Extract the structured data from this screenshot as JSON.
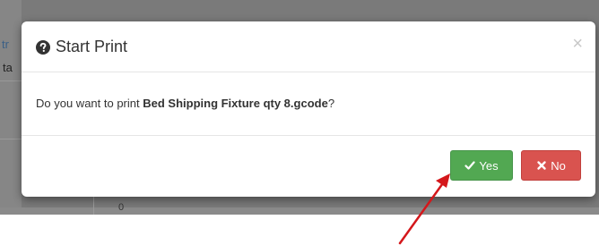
{
  "background": {
    "fragment_1": "tr",
    "fragment_2": "ta",
    "fragment_3": "0"
  },
  "dialog": {
    "title": "Start Print",
    "title_icon": "question-circle-icon",
    "close_label": "×",
    "message_prefix": "Do you want to print ",
    "message_filename": "Bed Shipping Fixture qty 8.gcode",
    "message_suffix": "?",
    "yes_label": "Yes",
    "yes_icon": "checkmark-icon",
    "no_label": "No",
    "no_icon": "x-icon"
  },
  "colors": {
    "yes_button": "#52a852",
    "no_button": "#d9534f",
    "annotation_arrow": "#d4171b"
  }
}
